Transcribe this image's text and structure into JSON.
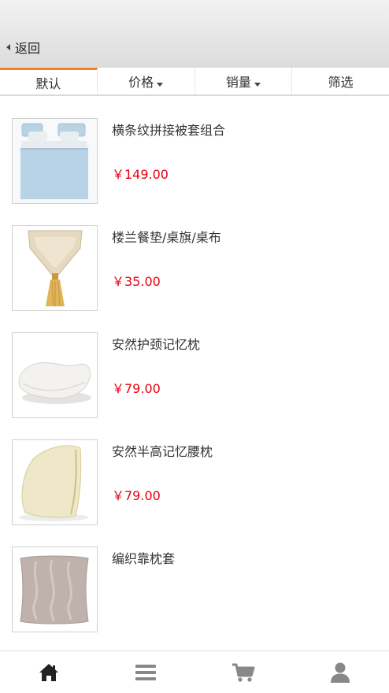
{
  "header": {
    "back_label": "返回"
  },
  "tabs": [
    {
      "label": "默认",
      "active": true,
      "has_caret": false
    },
    {
      "label": "价格",
      "active": false,
      "has_caret": true
    },
    {
      "label": "销量",
      "active": false,
      "has_caret": true
    },
    {
      "label": "筛选",
      "active": false,
      "has_caret": false
    }
  ],
  "products": [
    {
      "name": "横条纹拼接被套组合",
      "price": "￥149.00",
      "image": "bedding-set"
    },
    {
      "name": "楼兰餐垫/桌旗/桌布",
      "price": "￥35.00",
      "image": "table-runner"
    },
    {
      "name": "安然护颈记忆枕",
      "price": "￥79.00",
      "image": "memory-pillow"
    },
    {
      "name": "安然半高记忆腰枕",
      "price": "￥79.00",
      "image": "lumbar-pillow"
    },
    {
      "name": "编织靠枕套",
      "price": "",
      "image": "knit-cushion"
    }
  ],
  "bottom_nav": [
    {
      "icon": "home-icon",
      "active": true
    },
    {
      "icon": "menu-icon",
      "active": false
    },
    {
      "icon": "cart-icon",
      "active": false
    },
    {
      "icon": "user-icon",
      "active": false
    }
  ],
  "colors": {
    "accent": "#f58220",
    "price": "#e60012",
    "nav_active": "#222222",
    "nav_inactive": "#888888"
  }
}
